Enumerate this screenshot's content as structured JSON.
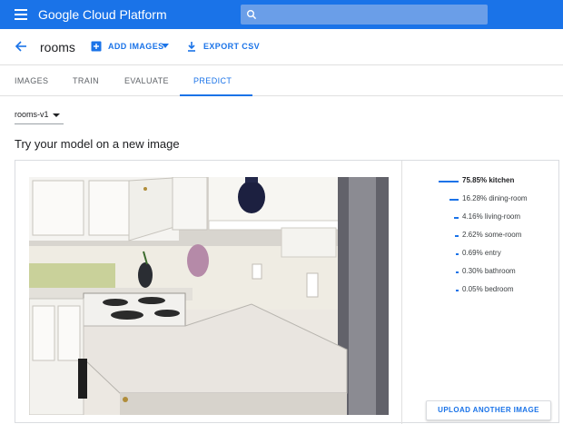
{
  "app": {
    "brand": "Google Cloud Platform",
    "brand_color": "#1a73e8"
  },
  "header": {
    "title": "rooms",
    "add_images": "ADD IMAGES",
    "export_csv": "EXPORT CSV"
  },
  "tabs": [
    {
      "label": "IMAGES",
      "active": false
    },
    {
      "label": "TRAIN",
      "active": false
    },
    {
      "label": "EVALUATE",
      "active": false
    },
    {
      "label": "PREDICT",
      "active": true
    }
  ],
  "model_select": {
    "value": "rooms-v1"
  },
  "section": {
    "title": "Try your model on a new image"
  },
  "predictions": [
    {
      "label": "75.85% kitchen",
      "score": 0.7585
    },
    {
      "label": "16.28% dining-room",
      "score": 0.1628
    },
    {
      "label": "4.16% living-room",
      "score": 0.0416
    },
    {
      "label": "2.62% some-room",
      "score": 0.0262
    },
    {
      "label": "0.69% entry",
      "score": 0.0069
    },
    {
      "label": "0.30% bathroom",
      "score": 0.003
    },
    {
      "label": "0.05% bedroom",
      "score": 0.0005
    }
  ],
  "upload_button": "UPLOAD ANOTHER IMAGE",
  "icons": {
    "menu": "menu-icon",
    "search": "search-icon",
    "back": "arrow-left-icon",
    "add": "add-box-icon",
    "export": "download-icon",
    "caret": "caret-down-icon"
  }
}
